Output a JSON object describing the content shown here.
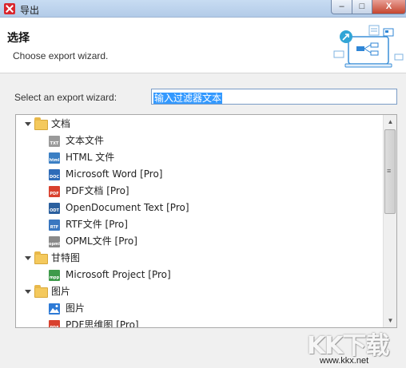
{
  "window": {
    "title": "导出",
    "minimize_label": "–",
    "maximize_label": "□",
    "close_label": "X"
  },
  "header": {
    "title": "选择",
    "subtitle": "Choose export wizard."
  },
  "filter": {
    "label": "Select an export wizard:",
    "value": "输入过滤器文本"
  },
  "tree": {
    "groups": [
      {
        "label": "文档",
        "items": [
          {
            "label": "文本文件",
            "icon": "txt-icon",
            "badge": "TXT",
            "color": "#9a9a9a"
          },
          {
            "label": "HTML 文件",
            "icon": "html-icon",
            "badge": "html",
            "color": "#3b7fc4"
          },
          {
            "label": "Microsoft Word [Pro]",
            "icon": "doc-icon",
            "badge": "DOC",
            "color": "#2e6bb8"
          },
          {
            "label": "PDF文档 [Pro]",
            "icon": "pdf-icon",
            "badge": "PDF",
            "color": "#d9412e"
          },
          {
            "label": "OpenDocument Text [Pro]",
            "icon": "odt-icon",
            "badge": "ODT",
            "color": "#2a5f9e"
          },
          {
            "label": "RTF文件 [Pro]",
            "icon": "rtf-icon",
            "badge": "RTF",
            "color": "#3a77c0"
          },
          {
            "label": "OPML文件 [Pro]",
            "icon": "opml-icon",
            "badge": "opml",
            "color": "#8a8a8a"
          }
        ]
      },
      {
        "label": "甘特图",
        "items": [
          {
            "label": "Microsoft Project [Pro]",
            "icon": "mpp-icon",
            "badge": "mpp",
            "color": "#3e9a4a"
          }
        ]
      },
      {
        "label": "图片",
        "items": [
          {
            "label": "图片",
            "icon": "image-icon",
            "badge": "",
            "color": "#2d7ad6"
          },
          {
            "label": "PDF思维图 [Pro]",
            "icon": "pdf-icon",
            "badge": "PDF",
            "color": "#d9412e"
          }
        ]
      }
    ]
  },
  "watermark": {
    "text": "KK下载",
    "url": "www.kkx.net"
  }
}
